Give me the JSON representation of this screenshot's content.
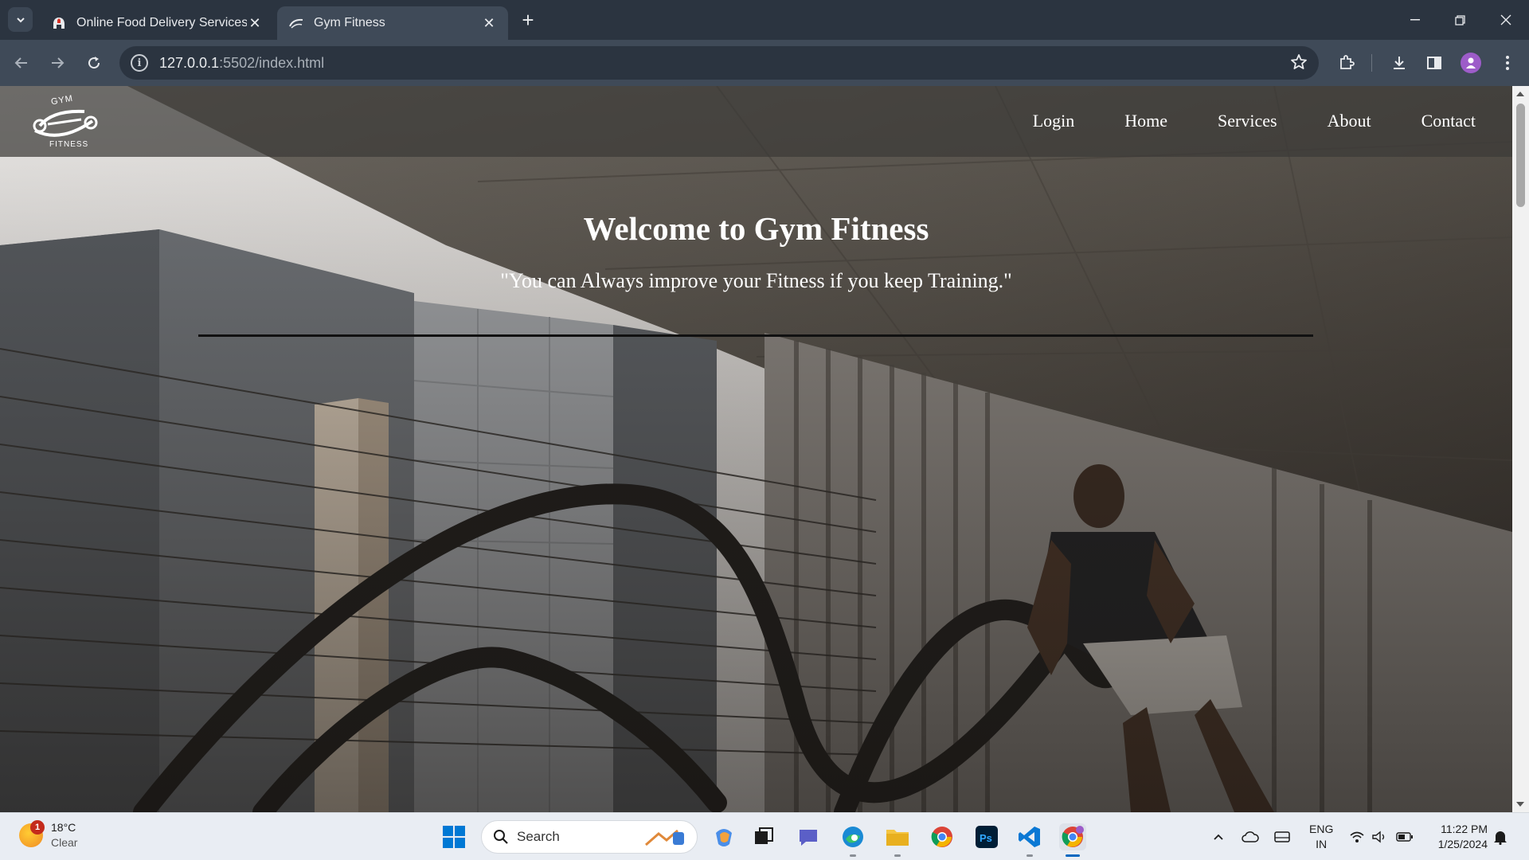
{
  "browser": {
    "tabs": [
      {
        "title": "Online Food Delivery Services",
        "active": false
      },
      {
        "title": "Gym Fitness",
        "active": true
      }
    ],
    "url_host": "127.0.0.1",
    "url_rest": ":5502/index.html"
  },
  "site": {
    "logo_top": "GYM",
    "logo_bottom": "FITNESS",
    "nav": [
      "Login",
      "Home",
      "Services",
      "About",
      "Contact"
    ],
    "hero_title": "Welcome to Gym Fitness",
    "hero_quote": "\"You can Always improve your Fitness if you keep Training.\""
  },
  "taskbar": {
    "weather_badge": "1",
    "temperature": "18°C",
    "condition": "Clear",
    "search_label": "Search",
    "lang_line1": "ENG",
    "lang_line2": "IN",
    "time": "11:22 PM",
    "date": "1/25/2024"
  }
}
